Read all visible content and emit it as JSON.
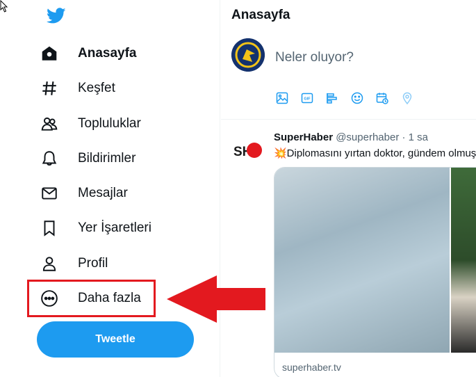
{
  "sidebar": {
    "items": [
      {
        "label": "Anasayfa",
        "icon": "home-icon",
        "active": true
      },
      {
        "label": "Keşfet",
        "icon": "hashtag-icon"
      },
      {
        "label": "Topluluklar",
        "icon": "communities-icon"
      },
      {
        "label": "Bildirimler",
        "icon": "bell-icon"
      },
      {
        "label": "Mesajlar",
        "icon": "mail-icon"
      },
      {
        "label": "Yer İşaretleri",
        "icon": "bookmark-icon"
      },
      {
        "label": "Profil",
        "icon": "person-icon"
      },
      {
        "label": "Daha fazla",
        "icon": "more-circle-icon"
      }
    ],
    "tweet_button": "Tweetle"
  },
  "main": {
    "title": "Anasayfa",
    "compose_placeholder": "Neler oluyor?",
    "toolbar_icons": [
      "image-icon",
      "gif-icon",
      "poll-icon",
      "emoji-icon",
      "schedule-icon",
      "location-icon"
    ]
  },
  "tweet": {
    "name": "SuperHaber",
    "handle": "@superhaber",
    "time": "· 1 sa",
    "text": "💥Diplomasını yırtan doktor, gündem olmuş",
    "link": "superhaber.tv",
    "avatar_text": "SH"
  },
  "colors": {
    "accent": "#1d9bf0",
    "highlight": "#e3191f"
  }
}
